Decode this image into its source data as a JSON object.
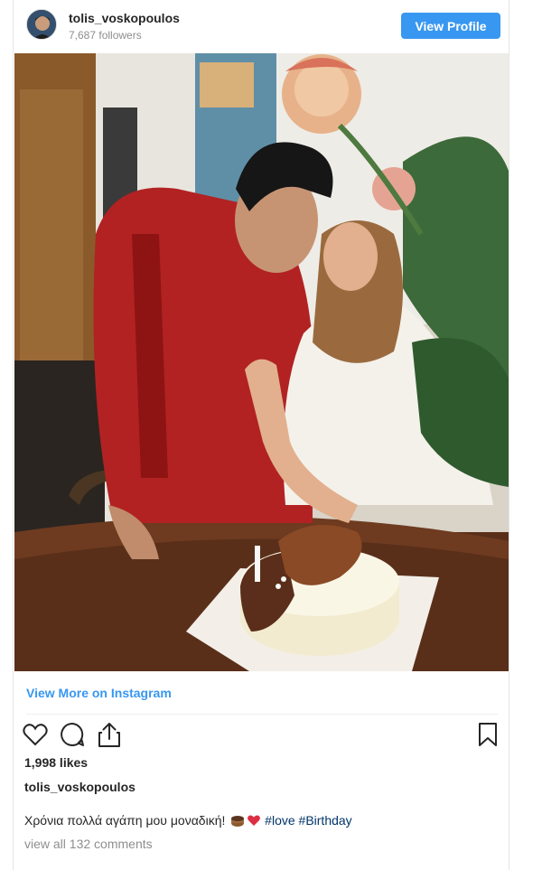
{
  "header": {
    "username": "tolis_voskopoulos",
    "followers": "7,687 followers",
    "view_profile_label": "View Profile"
  },
  "post": {
    "view_more_label": "View More on Instagram",
    "likes": "1,998 likes",
    "caption_user": "tolis_voskopoulos",
    "caption_text": "Χρόνια πολλά αγάπη μου μοναδική! ",
    "hashtags": [
      "#love",
      "#Birthday"
    ],
    "comments_link": "view all 132 comments"
  },
  "icons": {
    "like": "heart-outline-icon",
    "comment": "speech-bubble-icon",
    "share": "share-icon",
    "save": "bookmark-icon",
    "caption_emojis": [
      "cake-emoji",
      "red-heart-emoji"
    ]
  },
  "colors": {
    "accent_blue": "#3897f0",
    "hashtag": "#003569",
    "muted": "#8e8e8e",
    "text": "#262626"
  }
}
